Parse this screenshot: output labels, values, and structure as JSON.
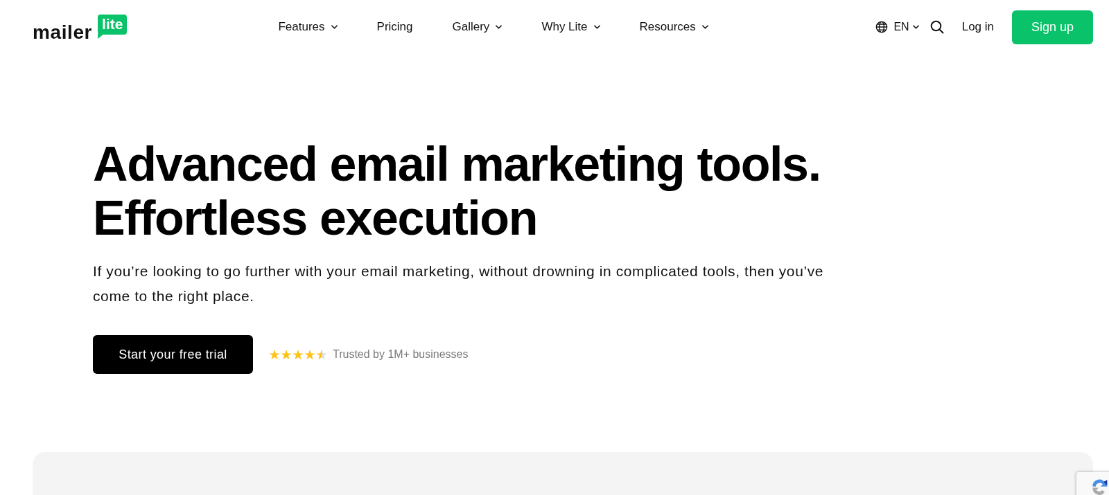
{
  "header": {
    "logo": {
      "wordmark": "mailer",
      "tag": "lite"
    },
    "nav": [
      {
        "label": "Features",
        "dropdown": true
      },
      {
        "label": "Pricing",
        "dropdown": false
      },
      {
        "label": "Gallery",
        "dropdown": true
      },
      {
        "label": "Why Lite",
        "dropdown": true
      },
      {
        "label": "Resources",
        "dropdown": true
      }
    ],
    "language": {
      "label": "EN",
      "dropdown": true
    },
    "login": "Log in",
    "signup": "Sign up"
  },
  "hero": {
    "title_lines": [
      "Advanced email marketing tools.",
      "Effortless execution"
    ],
    "subtitle": "If you’re looking to go further with your email marketing, without drowning in complicated tools, then you’ve come to the right place.",
    "cta": "Start your free trial",
    "rating": {
      "stars": 4.5,
      "text": "Trusted by 1M+ businesses"
    }
  }
}
